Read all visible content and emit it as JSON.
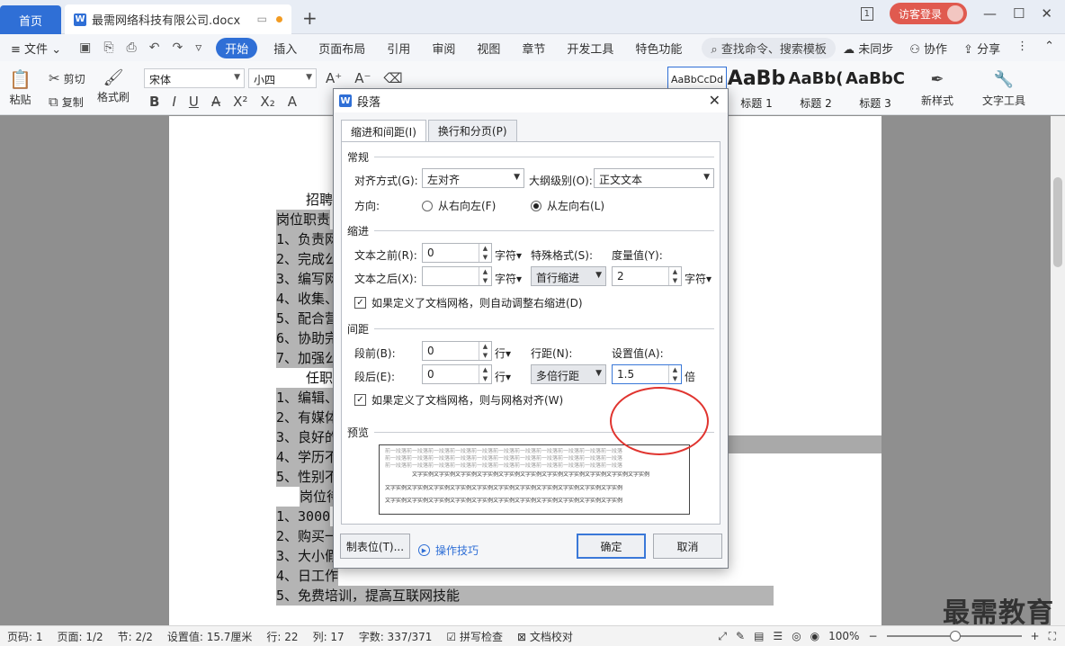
{
  "tabs": {
    "home": "首页",
    "doc_title": "最需网络科技有限公司.docx",
    "add": "+"
  },
  "window": {
    "page_indicator": "1",
    "login_label": "访客登录"
  },
  "menu": {
    "file": "文件",
    "items": [
      "开始",
      "插入",
      "页面布局",
      "引用",
      "审阅",
      "视图",
      "章节",
      "开发工具",
      "特色功能"
    ],
    "search": "查找命令、搜索模板",
    "sync": "未同步",
    "collab": "协作",
    "share": "分享"
  },
  "ribbon": {
    "paste": "粘贴",
    "cut": "剪切",
    "copy": "复制",
    "format_painter": "格式刷",
    "font": "宋体",
    "size": "小四",
    "styles": [
      {
        "preview": "AaBbCcDd",
        "name": ""
      },
      {
        "preview": "AaBb",
        "name": "标题 1"
      },
      {
        "preview": "AaBb(",
        "name": "标题 2"
      },
      {
        "preview": "AaBbC",
        "name": "标题 3"
      }
    ],
    "new_style": "新样式",
    "text_tools": "文字工具"
  },
  "document": {
    "lines": [
      "招聘",
      "岗位职责",
      "1、负责网",
      "2、完成公",
      "3、编写网",
      "4、收集、",
      "5、配合营",
      "6、协助完",
      "7、加强公",
      "任职",
      "1、编辑、",
      "2、有媒体",
      "3、良好的",
      "4、学历不",
      "5、性别不",
      "岗位待",
      "1、3000",
      "2、购买一",
      "3、大小假",
      "4、日工作",
      "5、免费培训，提高互联网技能"
    ]
  },
  "watermark": "最需教育",
  "status": {
    "page_code": "页码: 1",
    "page": "页面: 1/2",
    "section": "节: 2/2",
    "setting": "设置值: 15.7厘米",
    "row": "行: 22",
    "col": "列: 17",
    "words": "字数: 337/371",
    "spell": "拼写检查",
    "proof": "文档校对",
    "zoom": "100%"
  },
  "dialog": {
    "title": "段落",
    "tabs": [
      "缩进和间距(I)",
      "换行和分页(P)"
    ],
    "general": {
      "section": "常规",
      "align_label": "对齐方式(G):",
      "align_value": "左对齐",
      "outline_label": "大纲级别(O):",
      "outline_value": "正文文本",
      "direction_label": "方向:",
      "rtl": "从右向左(F)",
      "ltr": "从左向右(L)"
    },
    "indent": {
      "section": "缩进",
      "before_label": "文本之前(R):",
      "before_value": "0",
      "after_label": "文本之后(X):",
      "after_value": "",
      "unit": "字符",
      "special_label": "特殊格式(S):",
      "special_value": "首行缩进",
      "measure_label": "度量值(Y):",
      "measure_value": "2",
      "measure_unit": "字符",
      "grid_check": "如果定义了文档网格，则自动调整右缩进(D)"
    },
    "spacing": {
      "section": "间距",
      "before_label": "段前(B):",
      "before_value": "0",
      "after_label": "段后(E):",
      "after_value": "0",
      "unit": "行",
      "line_label": "行距(N):",
      "line_value": "多倍行距",
      "set_label": "设置值(A):",
      "set_value": "1.5",
      "set_unit": "倍",
      "grid_check": "如果定义了文档网格，则与网格对齐(W)"
    },
    "preview": {
      "section": "预览",
      "prev_text": "前一段落前一段落前一段落前一段落前一段落前一段落前一段落前一段落前一段落前一段落前一段落",
      "sample_text": "文字实例文字实例文字实例文字实例文字实例文字实例文字实例文字实例文字实例文字实例文字实例"
    },
    "buttons": {
      "tabs": "制表位(T)...",
      "tips": "操作技巧",
      "ok": "确定",
      "cancel": "取消"
    }
  },
  "colors": {
    "accent": "#2f6fd6",
    "highlight": "#e0342f"
  }
}
